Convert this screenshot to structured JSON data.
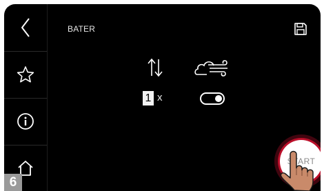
{
  "screen": {
    "title": "BATER"
  },
  "sidebar": {
    "items": [
      {
        "icon": "back-chevron-icon"
      },
      {
        "icon": "star-icon"
      },
      {
        "icon": "info-icon"
      },
      {
        "icon": "home-icon"
      }
    ]
  },
  "toolbar": {
    "save_icon": "save-icon"
  },
  "options": {
    "direction_icon": "up-down-arrows-icon",
    "airflow_icon": "air-wind-icon",
    "quantity_value": "1",
    "quantity_suffix": "x",
    "toggle_state": "on"
  },
  "start_button": {
    "label": "START"
  },
  "annotation": {
    "step_number": "6"
  },
  "colors": {
    "background": "#000000",
    "accent": "#bb0f2a",
    "foreground": "#ffffff"
  }
}
